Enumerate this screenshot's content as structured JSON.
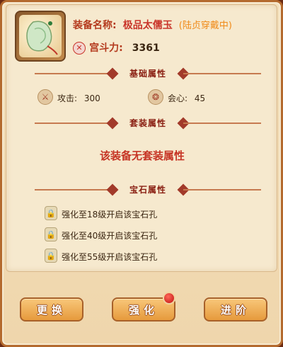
{
  "item": {
    "name_label": "装备名称:",
    "name_value": "极品太儒玉",
    "equipped_status": "(陆贞穿戴中)",
    "power_label": "宫斗力:",
    "power_value": "3361",
    "icon": "jade-pendant-icon"
  },
  "sections": {
    "base": {
      "title": "基础属性"
    },
    "set": {
      "title": "套装属性",
      "message": "该装备无套装属性"
    },
    "gem": {
      "title": "宝石属性"
    }
  },
  "base_attrs": [
    {
      "label": "攻击: ",
      "value": "300",
      "icon": "sword-icon"
    },
    {
      "label": "会心: ",
      "value": "45",
      "icon": "crit-icon"
    }
  ],
  "gem_slots": [
    {
      "text": "强化至18级开启该宝石孔",
      "icon": "lock-icon"
    },
    {
      "text": "强化至40级开启该宝石孔",
      "icon": "lock-icon"
    },
    {
      "text": "强化至55级开启该宝石孔",
      "icon": "lock-icon"
    }
  ],
  "buttons": {
    "replace": "更换",
    "enhance": "强化",
    "advance": "进阶"
  },
  "colors": {
    "accent_red": "#c9352a",
    "status_orange": "#f08a18",
    "button_orange": "#e69a3c",
    "lock_green": "#3c8a3c"
  }
}
